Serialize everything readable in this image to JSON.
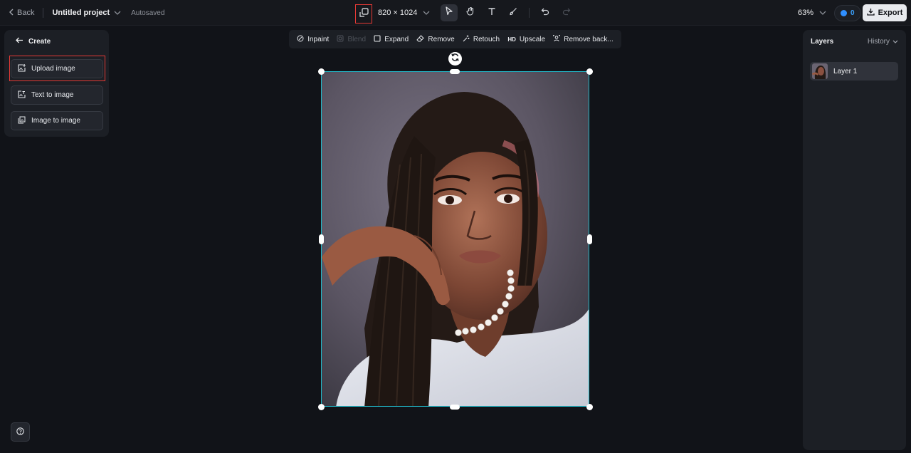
{
  "topbar": {
    "back_label": "Back",
    "project_name": "Untitled project",
    "save_status": "Autosaved",
    "canvas_size": "820 × 1024",
    "zoom_level": "63%",
    "credits": "0",
    "export_label": "Export"
  },
  "left_panel": {
    "title": "Create",
    "buttons": [
      {
        "label": "Upload image",
        "icon": "upload-image-icon"
      },
      {
        "label": "Text to image",
        "icon": "text-to-image-icon"
      },
      {
        "label": "Image to image",
        "icon": "image-to-image-icon"
      }
    ]
  },
  "edit_toolbar": {
    "items": [
      {
        "label": "Inpaint",
        "icon": "inpaint-icon",
        "enabled": true
      },
      {
        "label": "Blend",
        "icon": "blend-icon",
        "enabled": false
      },
      {
        "label": "Expand",
        "icon": "expand-icon",
        "enabled": true
      },
      {
        "label": "Remove",
        "icon": "eraser-icon",
        "enabled": true
      },
      {
        "label": "Retouch",
        "icon": "retouch-icon",
        "enabled": true
      },
      {
        "label": "Upscale",
        "icon": "hd-icon",
        "icon_text": "HD",
        "enabled": true
      },
      {
        "label": "Remove back...",
        "icon": "remove-background-icon",
        "enabled": true
      }
    ]
  },
  "right_panel": {
    "layers_title": "Layers",
    "history_label": "History",
    "layers": [
      {
        "name": "Layer 1",
        "selected": true
      }
    ]
  },
  "colors": {
    "background": "#111318",
    "panel": "#1c1f25",
    "selection": "#22b8c8",
    "highlight_box": "#e53935",
    "credit_accent": "#2f8fff"
  }
}
